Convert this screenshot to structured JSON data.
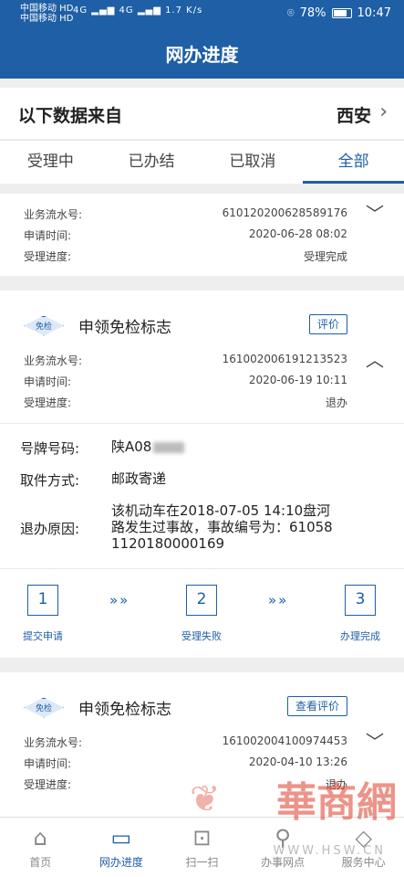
{
  "status_bar": {
    "carrier1": "中国移动 HD",
    "carrier2": "中国移动 HD",
    "signal": "4G ▂▄▆ 4G ▂▄▆ 1.7 K/s",
    "battery": "78%",
    "time": "10:47"
  },
  "header": {
    "title": "网办进度"
  },
  "source": {
    "label": "以下数据来自",
    "city": "西安"
  },
  "tabs": [
    {
      "label": "受理中"
    },
    {
      "label": "已办结"
    },
    {
      "label": "已取消"
    },
    {
      "label": "全部"
    }
  ],
  "labels": {
    "serial": "业务流水号:",
    "apply_time": "申请时间:",
    "progress": "受理进度:"
  },
  "record1": {
    "serial": "610120200628589176",
    "apply_time": "2020-06-28 08:02",
    "progress": "受理完成"
  },
  "record2": {
    "badge": "免检",
    "service": "申领免检标志",
    "eval_btn": "评价",
    "serial": "161002006191213523",
    "apply_time": "2020-06-19 10:11",
    "progress": "退办",
    "plate_label": "号牌号码:",
    "plate_value": "陕A08",
    "pickup_label": "取件方式:",
    "pickup_value": "邮政寄递",
    "reason_label": "退办原因:",
    "reason_value": "该机动车在2018-07-05 14:10盘河路发生过事故，事故编号为：610581120180000169",
    "steps": [
      {
        "num": "1",
        "label": "提交申请"
      },
      {
        "num": "2",
        "label": "受理失败"
      },
      {
        "num": "3",
        "label": "办理完成"
      }
    ],
    "arrow": "»»"
  },
  "record3": {
    "badge": "免检",
    "service": "申领免检标志",
    "eval_btn": "查看评价",
    "serial": "161002004100974453",
    "apply_time": "2020-04-10 13:26",
    "progress": "退办"
  },
  "bottom_nav": [
    {
      "label": "首页",
      "icon": "home-icon"
    },
    {
      "label": "网办进度",
      "icon": "monitor-icon"
    },
    {
      "label": "扫一扫",
      "icon": "scan-icon"
    },
    {
      "label": "办事网点",
      "icon": "location-icon"
    },
    {
      "label": "服务中心",
      "icon": "service-icon"
    }
  ],
  "watermark": {
    "text": "華商網",
    "url": "WWW.HSW.CN"
  },
  "colors": {
    "primary": "#1e5fa6",
    "background": "#eeeeee"
  }
}
